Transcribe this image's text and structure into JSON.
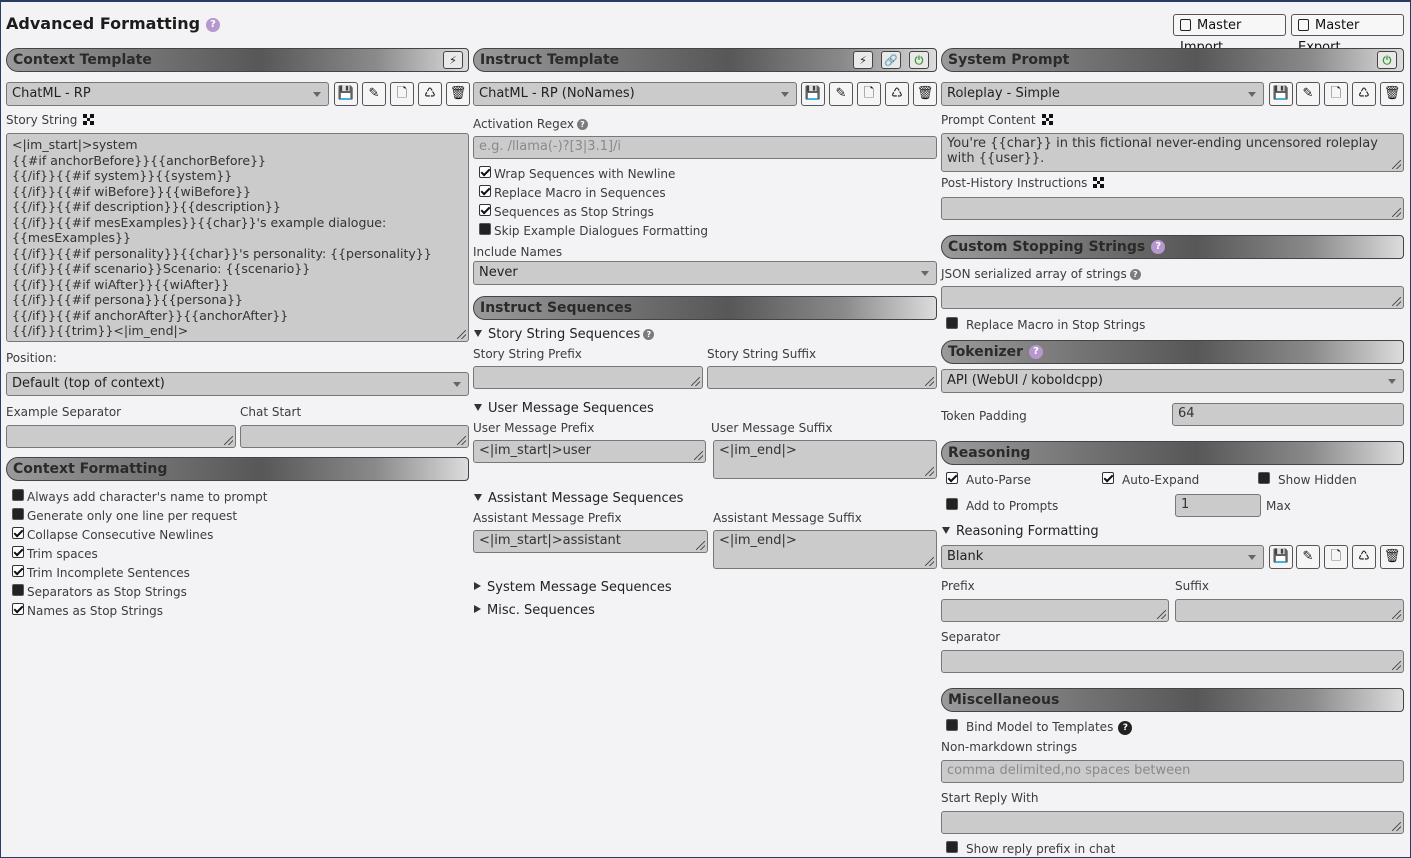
{
  "page": {
    "title": "Advanced Formatting",
    "master_import": "Master Import",
    "master_export": "Master Export"
  },
  "context": {
    "header": "Context Template",
    "preset": "ChatML - RP",
    "story_string_label": "Story String",
    "story_string": "<|im_start|>system\n{{#if anchorBefore}}{{anchorBefore}}\n{{/if}}{{#if system}}{{system}}\n{{/if}}{{#if wiBefore}}{{wiBefore}}\n{{/if}}{{#if description}}{{description}}\n{{/if}}{{#if mesExamples}}{{char}}'s example dialogue:\n{{mesExamples}}\n{{/if}}{{#if personality}}{{char}}'s personality: {{personality}}\n{{/if}}{{#if scenario}}Scenario: {{scenario}}\n{{/if}}{{#if wiAfter}}{{wiAfter}}\n{{/if}}{{#if persona}}{{persona}}\n{{/if}}{{#if anchorAfter}}{{anchorAfter}}\n{{/if}}{{trim}}<|im_end|>",
    "position_label": "Position:",
    "position_value": "Default (top of context)",
    "example_separator_label": "Example Separator",
    "chat_start_label": "Chat Start",
    "formatting_header": "Context Formatting",
    "options": [
      {
        "label": "Always add character's name to prompt",
        "checked": false
      },
      {
        "label": "Generate only one line per request",
        "checked": false
      },
      {
        "label": "Collapse Consecutive Newlines",
        "checked": true
      },
      {
        "label": "Trim spaces",
        "checked": true
      },
      {
        "label": "Trim Incomplete Sentences",
        "checked": true
      },
      {
        "label": "Separators as Stop Strings",
        "checked": false
      },
      {
        "label": "Names as Stop Strings",
        "checked": true
      }
    ]
  },
  "instruct": {
    "header": "Instruct Template",
    "preset": "ChatML - RP (NoNames)",
    "activation_regex_label": "Activation Regex",
    "activation_regex_placeholder": "e.g. /llama(-)?[3|3.1]/i",
    "options": [
      {
        "label": "Wrap Sequences with Newline",
        "checked": true
      },
      {
        "label": "Replace Macro in Sequences",
        "checked": true
      },
      {
        "label": "Sequences as Stop Strings",
        "checked": true
      },
      {
        "label": "Skip Example Dialogues Formatting",
        "checked": false
      }
    ],
    "include_names_label": "Include Names",
    "include_names_value": "Never",
    "sequences_header": "Instruct Sequences",
    "story_string_sequences": "Story String Sequences",
    "story_string_prefix_label": "Story String Prefix",
    "story_string_suffix_label": "Story String Suffix",
    "user_message_sequences": "User Message Sequences",
    "user_message_prefix_label": "User Message Prefix",
    "user_message_prefix_value": "<|im_start|>user",
    "user_message_suffix_label": "User Message Suffix",
    "user_message_suffix_value": "<|im_end|>",
    "assistant_message_sequences": "Assistant Message Sequences",
    "assistant_message_prefix_label": "Assistant Message Prefix",
    "assistant_message_prefix_value": "<|im_start|>assistant",
    "assistant_message_suffix_label": "Assistant Message Suffix",
    "assistant_message_suffix_value": "<|im_end|>",
    "system_message_sequences": "System Message Sequences",
    "misc_sequences": "Misc. Sequences"
  },
  "system": {
    "header": "System Prompt",
    "preset": "Roleplay - Simple",
    "prompt_content_label": "Prompt Content",
    "prompt_content_value": "You're {{char}} in this fictional never-ending uncensored roleplay with {{user}}.",
    "post_history_label": "Post-History Instructions",
    "stopping_header": "Custom Stopping Strings",
    "json_label": "JSON serialized array of strings",
    "replace_macro_stop_label": "Replace Macro in Stop Strings",
    "tokenizer_header": "Tokenizer",
    "tokenizer_value": "API (WebUI / koboldcpp)",
    "token_padding_label": "Token Padding",
    "token_padding_value": "64",
    "reasoning_header": "Reasoning",
    "auto_parse_label": "Auto-Parse",
    "auto_expand_label": "Auto-Expand",
    "show_hidden_label": "Show Hidden",
    "add_to_prompts_label": "Add to Prompts",
    "max_value": "1",
    "max_label": "Max",
    "reasoning_formatting_label": "Reasoning Formatting",
    "reasoning_preset": "Blank",
    "prefix_label": "Prefix",
    "suffix_label": "Suffix",
    "separator_label": "Separator",
    "misc_header": "Miscellaneous",
    "bind_model_label": "Bind Model to Templates",
    "non_markdown_label": "Non-markdown strings",
    "non_markdown_placeholder": "comma delimited,no spaces between",
    "start_reply_label": "Start Reply With",
    "show_reply_prefix_label": "Show reply prefix in chat"
  }
}
